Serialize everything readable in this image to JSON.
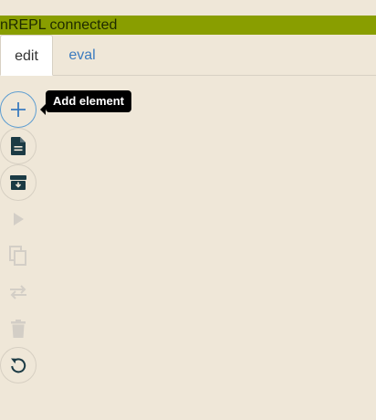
{
  "status": {
    "text": "nREPL connected",
    "color": "#899e00"
  },
  "tabs": [
    {
      "label": "edit",
      "active": true
    },
    {
      "label": "eval",
      "active": false
    }
  ],
  "toolbar": {
    "tooltip": "Add element",
    "tools": [
      {
        "icon": "plus-icon",
        "enabled": true
      },
      {
        "icon": "file-icon",
        "enabled": true
      },
      {
        "icon": "archive-icon",
        "enabled": true
      },
      {
        "icon": "play-icon",
        "enabled": false
      },
      {
        "icon": "copy-icon",
        "enabled": false
      },
      {
        "icon": "swap-icon",
        "enabled": false
      },
      {
        "icon": "trash-icon",
        "enabled": false
      },
      {
        "icon": "undo-icon",
        "enabled": true
      }
    ]
  },
  "colors": {
    "background": "#efe7d8",
    "accent": "#3b7bbf",
    "icon_active": "#1b3a44",
    "icon_disabled": "#d3cec6"
  }
}
